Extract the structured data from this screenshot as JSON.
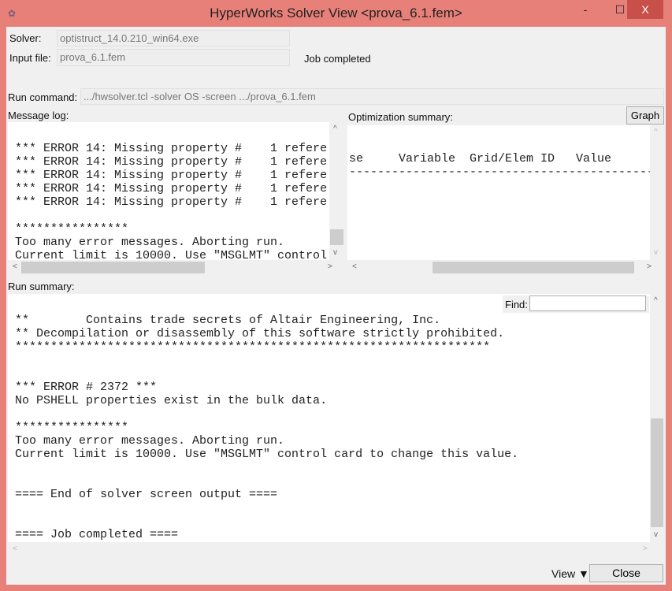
{
  "window": {
    "title": "HyperWorks Solver View <prova_6.1.fem>",
    "minimize": "-",
    "maximize": "☐",
    "close": "X"
  },
  "solver": {
    "label": "Solver:",
    "value": "optistruct_14.0.210_win64.exe"
  },
  "input_file": {
    "label": "Input file:",
    "value": "prova_6.1.fem"
  },
  "status": "Job completed",
  "run_command": {
    "label": "Run command:",
    "value": ".../hwsolver.tcl -solver OS -screen .../prova_6.1.fem"
  },
  "message_log": {
    "label": "Message log:",
    "lines": [
      "*** ERROR 14: Missing property #    1 refere",
      "*** ERROR 14: Missing property #    1 refere",
      "*** ERROR 14: Missing property #    1 refere",
      "*** ERROR 14: Missing property #    1 refere",
      "*** ERROR 14: Missing property #    1 refere",
      "",
      "****************",
      "Too many error messages. Aborting run.",
      "Current limit is 10000. Use \"MSGLMT\" control"
    ]
  },
  "optimization_summary": {
    "label": "Optimization summary:",
    "graph_button": "Graph",
    "lines": [
      "se     Variable  Grid/Elem ID   Value",
      "------------------------------------------------"
    ]
  },
  "run_summary": {
    "label": "Run summary:",
    "find_label": "Find:",
    "find_value": "",
    "lines": [
      "**        Contains trade secrets of Altair Engineering, Inc.",
      "** Decompilation or disassembly of this software strictly prohibited.",
      "*******************************************************************",
      "",
      "",
      "*** ERROR # 2372 ***",
      "No PSHELL properties exist in the bulk data.",
      "",
      "****************",
      "Too many error messages. Aborting run.",
      "Current limit is 10000. Use \"MSGLMT\" control card to change this value.",
      "",
      "",
      "==== End of solver screen output ====",
      "",
      "",
      "==== Job completed ===="
    ]
  },
  "footer": {
    "view": "View ▼",
    "close": "Close"
  }
}
